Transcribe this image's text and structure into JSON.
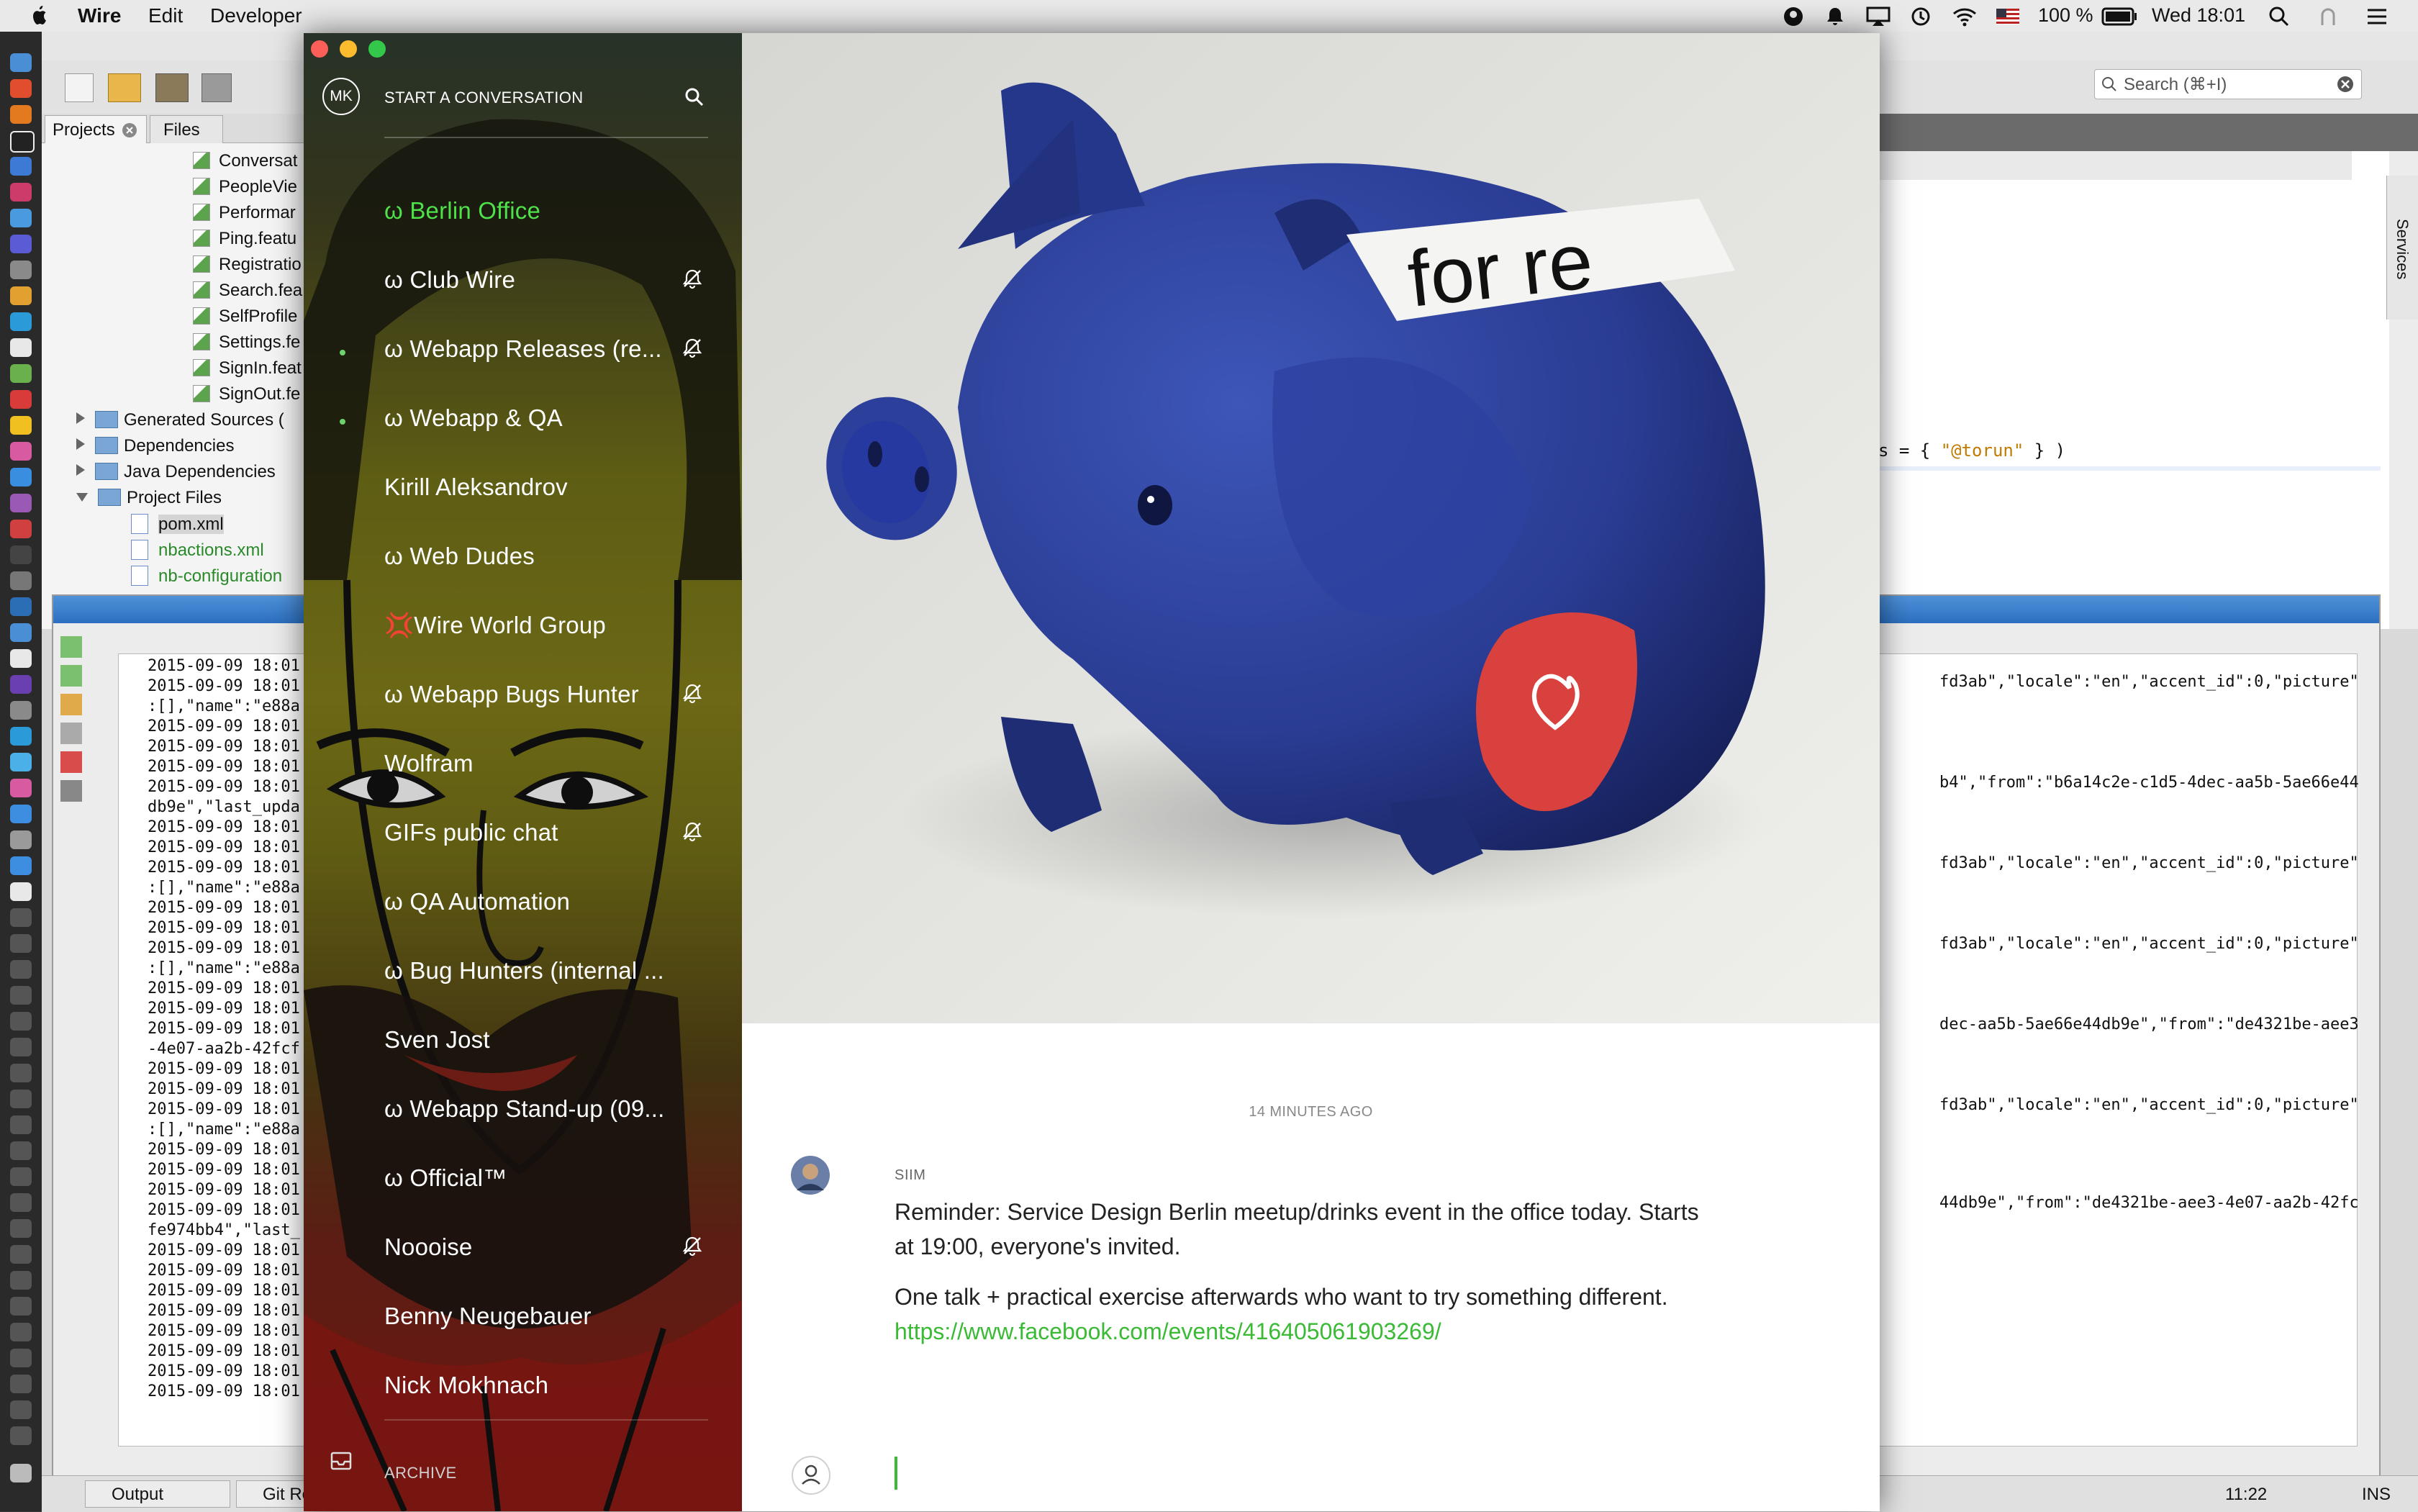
{
  "menubar": {
    "app_name": "Wire",
    "items": [
      "Edit",
      "Developer"
    ],
    "battery": "100 %",
    "clock": "Wed 18:01"
  },
  "ide": {
    "search_placeholder": "Search (⌘+I)",
    "tabs": {
      "projects": "Projects",
      "files": "Files"
    },
    "tree_files": [
      "Conversat",
      "PeopleVie",
      "Performar",
      "Ping.featu",
      "Registratio",
      "Search.fea",
      "SelfProfile",
      "Settings.fe",
      "SignIn.feat",
      "SignOut.fe"
    ],
    "tree_nodes": [
      "Generated Sources (",
      "Dependencies",
      "Java Dependencies",
      "Project Files"
    ],
    "project_files": [
      "pom.xml",
      "nbactions.xml",
      "nb-configuration"
    ],
    "editor_snippet": {
      "prefix": "s  = { ",
      "value": "\"@torun\"",
      "suffix": " } )"
    },
    "services_label": "Services",
    "log_lines": [
      "2015-09-09 18:01",
      "2015-09-09 18:01",
      ":[],\"name\":\"e88a",
      "2015-09-09 18:01",
      "2015-09-09 18:01",
      "2015-09-09 18:01",
      "2015-09-09 18:01",
      "db9e\",\"last_upda",
      "2015-09-09 18:01",
      "2015-09-09 18:01",
      "2015-09-09 18:01",
      ":[],\"name\":\"e88a",
      "2015-09-09 18:01",
      "2015-09-09 18:01",
      "2015-09-09 18:01",
      ":[],\"name\":\"e88a",
      "2015-09-09 18:01",
      "2015-09-09 18:01",
      "2015-09-09 18:01",
      "-4e07-aa2b-42fcf",
      "2015-09-09 18:01",
      "2015-09-09 18:01",
      "2015-09-09 18:01",
      ":[],\"name\":\"e88a",
      "2015-09-09 18:01",
      "2015-09-09 18:01",
      "2015-09-09 18:01",
      "2015-09-09 18:01",
      "fe974bb4\",\"last_",
      "2015-09-09 18:01",
      "2015-09-09 18:01",
      "2015-09-09 18:01",
      "2015-09-09 18:01",
      "2015-09-09 18:01",
      "2015-09-09 18:01",
      "2015-09-09 18:01",
      "2015-09-09 18:01"
    ],
    "right_log_lines": [
      "fd3ab\",\"locale\":\"en\",\"accent_id\":0,\"picture\"",
      "b4\",\"from\":\"b6a14c2e-c1d5-4dec-aa5b-5ae66e44",
      "fd3ab\",\"locale\":\"en\",\"accent_id\":0,\"picture\"",
      "fd3ab\",\"locale\":\"en\",\"accent_id\":0,\"picture\"",
      "dec-aa5b-5ae66e44db9e\",\"from\":\"de4321be-aee3",
      "fd3ab\",\"locale\":\"en\",\"accent_id\":0,\"picture\"",
      "44db9e\",\"from\":\"de4321be-aee3-4e07-aa2b-42fc"
    ],
    "bottom_tabs": [
      "Output",
      "Git Reposi"
    ],
    "status_time": "11:22",
    "status_mode": "INS"
  },
  "wire": {
    "avatar_initials": "MK",
    "start_conversation": "START A CONVERSATION",
    "archive_label": "ARCHIVE",
    "conversations": [
      {
        "name": "ω Berlin Office",
        "active": true,
        "muted": false,
        "unread": false
      },
      {
        "name": "ω Club Wire",
        "active": false,
        "muted": true,
        "unread": false
      },
      {
        "name": "ω Webapp Releases (re...",
        "active": false,
        "muted": true,
        "unread": true
      },
      {
        "name": "ω Webapp & QA",
        "active": false,
        "muted": false,
        "unread": true
      },
      {
        "name": "Kirill Aleksandrov",
        "active": false,
        "muted": false,
        "unread": false
      },
      {
        "name": "ω Web Dudes",
        "active": false,
        "muted": false,
        "unread": false
      },
      {
        "name": "💢Wire World Group",
        "active": false,
        "muted": false,
        "unread": false
      },
      {
        "name": "ω Webapp Bugs Hunter",
        "active": false,
        "muted": true,
        "unread": false
      },
      {
        "name": "Wolfram",
        "active": false,
        "muted": false,
        "unread": false
      },
      {
        "name": "GIFs public chat",
        "active": false,
        "muted": true,
        "unread": false
      },
      {
        "name": "ω QA Automation",
        "active": false,
        "muted": false,
        "unread": false
      },
      {
        "name": "ω Bug Hunters (internal ...",
        "active": false,
        "muted": false,
        "unread": false
      },
      {
        "name": "Sven Jost",
        "active": false,
        "muted": false,
        "unread": false
      },
      {
        "name": "ω Webapp Stand-up (09...",
        "active": false,
        "muted": false,
        "unread": false
      },
      {
        "name": "ω Official™",
        "active": false,
        "muted": false,
        "unread": false
      },
      {
        "name": "Noooise",
        "active": false,
        "muted": true,
        "unread": false
      },
      {
        "name": "Benny Neugebauer",
        "active": false,
        "muted": false,
        "unread": false
      },
      {
        "name": "Nick Mokhnach",
        "active": false,
        "muted": false,
        "unread": false
      }
    ],
    "image_caption_text": "for re",
    "timestamp": "14 MINUTES AGO",
    "message": {
      "sender": "SIIM",
      "line1": "Reminder: Service Design Berlin meetup/drinks event in the office today. Starts",
      "line2": "at 19:00, everyone's invited.",
      "line3": "One talk + practical exercise afterwards who want to try something different.",
      "link": "https://www.facebook.com/events/416405061903269/"
    },
    "colors": {
      "accent": "#3aba35",
      "active_conv": "#4ee149"
    }
  }
}
